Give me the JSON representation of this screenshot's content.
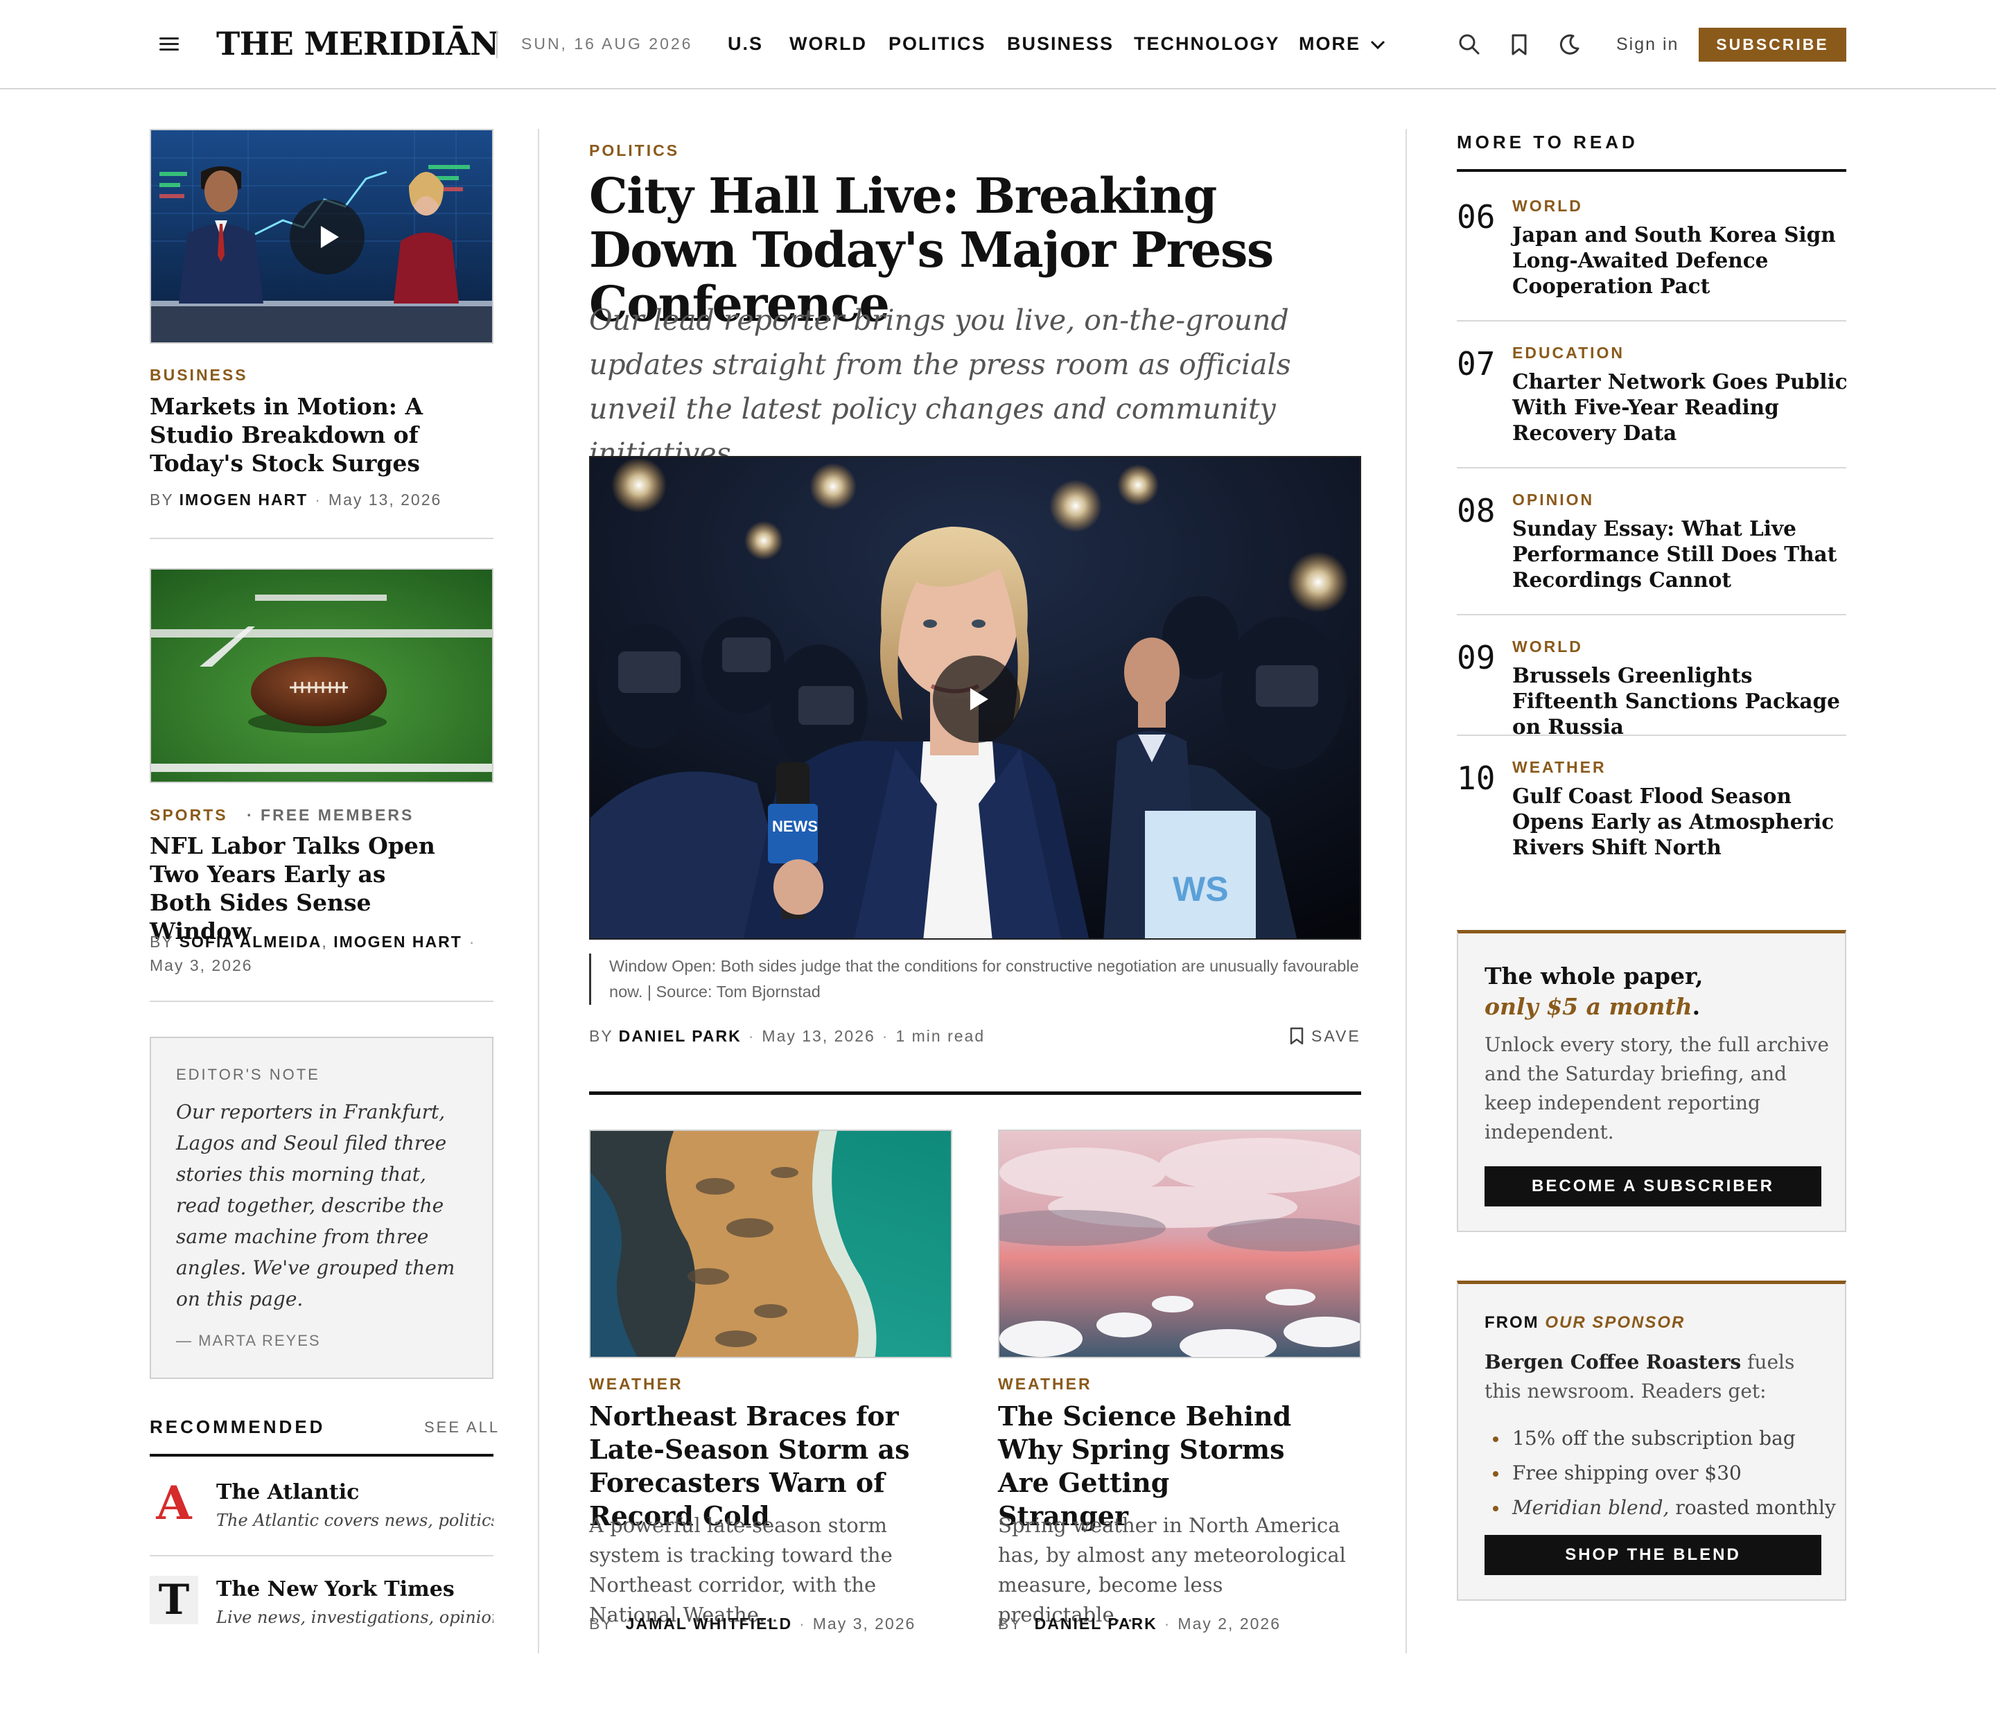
{
  "header": {
    "brand": "THE MERIDIĀN",
    "date": "SUN, 16 AUG 2026",
    "nav": [
      "U.S",
      "WORLD",
      "POLITICS",
      "BUSINESS",
      "TECHNOLOGY",
      "MORE"
    ],
    "sign_in": "Sign in",
    "subscribe": "SUBSCRIBE"
  },
  "left": {
    "story1": {
      "kicker": "BUSINESS",
      "title": "Markets in Motion: A Studio Breakdown of Today's Stock Surges",
      "by": "BY",
      "author": "IMOGEN HART",
      "date": "May 13, 2026"
    },
    "story2": {
      "kicker": "SPORTS",
      "tag": "FREE MEMBERS",
      "title": "NFL Labor Talks Open Two Years Early as Both Sides Sense Window",
      "by": "BY",
      "author1": "SOFIA ALMEIDA",
      "author2": "IMOGEN HART",
      "date": "May 3, 2026"
    },
    "editors_note": {
      "label": "EDITOR'S NOTE",
      "text": "Our reporters in Frankfurt, Lagos and Seoul filed three stories this morning that, read together, describe the same machine from three angles. We've grouped them on this page.",
      "signature": "— MARTA REYES"
    },
    "recommended": {
      "title": "RECOMMENDED",
      "see_all": "SEE ALL",
      "items": [
        {
          "logo": "A",
          "name": "The Atlantic",
          "desc": "The Atlantic covers news, politics, c"
        },
        {
          "logo": "T",
          "name": "The New York Times",
          "desc": "Live news, investigations, opinion,"
        }
      ]
    }
  },
  "lead": {
    "kicker": "POLITICS",
    "title": "City Hall Live: Breaking Down Today's Major Press Conference",
    "dek": "Our lead reporter brings you live, on-the-ground updates straight from the press room as officials unveil the latest policy changes and community initiatives.",
    "mic_flag": "NEWS",
    "caption": "Window Open: Both sides judge that the conditions for constructive negotiation are unusually favourable now. | Source: Tom Bjornstad",
    "by": "BY",
    "author": "DANIEL PARK",
    "date": "May 13, 2026",
    "read_time": "1 min read",
    "save": "SAVE"
  },
  "cards": [
    {
      "kicker": "WEATHER",
      "title": "Northeast Braces for Late-Season Storm as Forecasters Warn of Record Cold",
      "dek": "A powerful late-season storm system is tracking toward the Northeast corridor, with the National Weathe...",
      "by": "BY",
      "author": "JAMAL WHITFIELD",
      "date": "May 3, 2026"
    },
    {
      "kicker": "WEATHER",
      "title": "The Science Behind Why Spring Storms Are Getting Stranger",
      "dek": "Spring weather in North America has, by almost any meteorological measure, become less predictable...",
      "by": "BY",
      "author": "DANIEL PARK",
      "date": "May 2, 2026"
    }
  ],
  "more_to_read": {
    "title": "MORE TO READ",
    "items": [
      {
        "num": "06",
        "kicker": "WORLD",
        "title": "Japan and South Korea Sign Long-Awaited Defence Cooperation Pact"
      },
      {
        "num": "07",
        "kicker": "EDUCATION",
        "title": "Charter Network Goes Public With Five-Year Reading Recovery Data"
      },
      {
        "num": "08",
        "kicker": "OPINION",
        "title": "Sunday Essay: What Live Performance Still Does That Recordings Cannot"
      },
      {
        "num": "09",
        "kicker": "WORLD",
        "title": "Brussels Greenlights Fifteenth Sanctions Package on Russia"
      },
      {
        "num": "10",
        "kicker": "WEATHER",
        "title": "Gulf Coast Flood Season Opens Early as Atmospheric Rivers Shift North"
      }
    ]
  },
  "subscribe_promo": {
    "headline": "The whole paper,",
    "headline_em": "only $5 a month",
    "headline_end": ".",
    "text": "Unlock every story, the full archive and the Saturday briefing, and keep independent reporting independent.",
    "button": "BECOME A SUBSCRIBER"
  },
  "sponsor": {
    "label": "FROM",
    "label_em": "OUR SPONSOR",
    "sponsor_name": "Bergen Coffee Roasters",
    "text": "fuels this newsroom. Readers get:",
    "perks": [
      "15% off the subscription bag",
      "Free shipping over $30",
      "roasted monthly"
    ],
    "perk3_em": "Meridian blend,",
    "button": "SHOP THE BLEND"
  },
  "colors": {
    "accent": "#8a5a1b",
    "ink": "#111111",
    "panel": "#f4f4f4"
  }
}
